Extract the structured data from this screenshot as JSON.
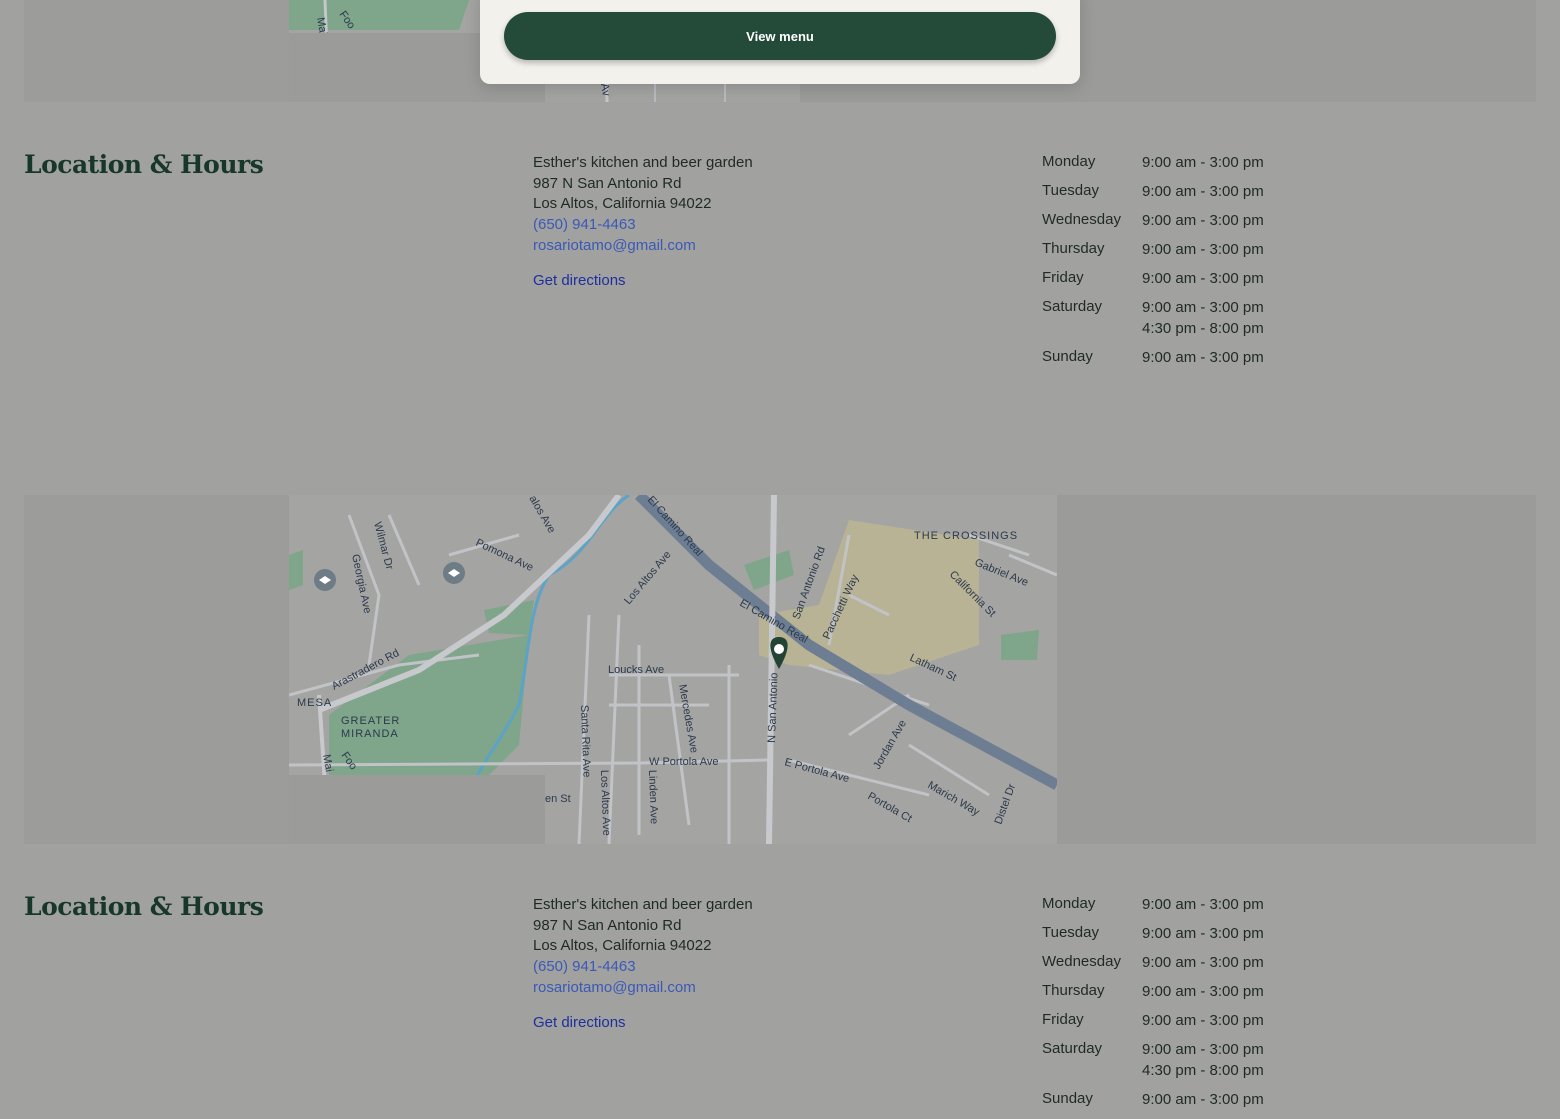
{
  "modal": {
    "view_menu_label": "View menu"
  },
  "map": {
    "labels": {
      "pomona": "Pomona Ave",
      "wilmar": "Wilmar Dr",
      "georgia": "Georgia Ave",
      "losaltos_top": "Los Altos Ave",
      "elcamino_top": "El Camino Real",
      "elcamino_mid": "El Camino Real",
      "sanantonio": "San Antonio Rd",
      "crossings": "THE CROSSINGS",
      "gabriel": "Gabriel Ave",
      "california": "California St",
      "pacchetti": "Pacchetti Way",
      "arastradero": "Arastradero Rd",
      "loucks": "Loucks Ave",
      "mercedes": "Mercedes Ave",
      "latham": "Latham St",
      "mesa": "MESA",
      "greater": "GREATER",
      "miranda": "MIRANDA",
      "santarita": "Santa Rita Ave",
      "wportola": "W Portola Ave",
      "nsanantonio": "N San Antonio",
      "eportola": "E Portola Ave",
      "jordan": "Jordan Ave",
      "losaltos_bottom": "Los Altos Ave",
      "linden": "Linden Ave",
      "portolact": "Portola Ct",
      "marich": "Marich Way",
      "distel": "Distel Dr",
      "en_st": "en St"
    }
  },
  "sections": [
    {
      "title": "Location & Hours",
      "address": {
        "name": "Esther's kitchen and beer garden",
        "street": "987 N San Antonio Rd",
        "city": "Los Altos, California 94022",
        "phone": "(650) 941-4463",
        "email": "rosariotamo@gmail.com",
        "directions": "Get directions"
      },
      "hours": [
        {
          "day": "Monday",
          "times": [
            "9:00 am - 3:00 pm"
          ]
        },
        {
          "day": "Tuesday",
          "times": [
            "9:00 am - 3:00 pm"
          ]
        },
        {
          "day": "Wednesday",
          "times": [
            "9:00 am - 3:00 pm"
          ]
        },
        {
          "day": "Thursday",
          "times": [
            "9:00 am - 3:00 pm"
          ]
        },
        {
          "day": "Friday",
          "times": [
            "9:00 am - 3:00 pm"
          ]
        },
        {
          "day": "Saturday",
          "times": [
            "9:00 am - 3:00 pm",
            "4:30 pm - 8:00 pm"
          ]
        },
        {
          "day": "Sunday",
          "times": [
            "9:00 am - 3:00 pm"
          ]
        }
      ]
    },
    {
      "title": "Location & Hours",
      "address": {
        "name": "Esther's kitchen and beer garden",
        "street": "987 N San Antonio Rd",
        "city": "Los Altos, California 94022",
        "phone": "(650) 941-4463",
        "email": "rosariotamo@gmail.com",
        "directions": "Get directions"
      },
      "hours": [
        {
          "day": "Monday",
          "times": [
            "9:00 am - 3:00 pm"
          ]
        },
        {
          "day": "Tuesday",
          "times": [
            "9:00 am - 3:00 pm"
          ]
        },
        {
          "day": "Wednesday",
          "times": [
            "9:00 am - 3:00 pm"
          ]
        },
        {
          "day": "Thursday",
          "times": [
            "9:00 am - 3:00 pm"
          ]
        },
        {
          "day": "Friday",
          "times": [
            "9:00 am - 3:00 pm"
          ]
        },
        {
          "day": "Saturday",
          "times": [
            "9:00 am - 3:00 pm",
            "4:30 pm - 8:00 pm"
          ]
        },
        {
          "day": "Sunday",
          "times": [
            "9:00 am - 3:00 pm"
          ]
        }
      ]
    }
  ]
}
